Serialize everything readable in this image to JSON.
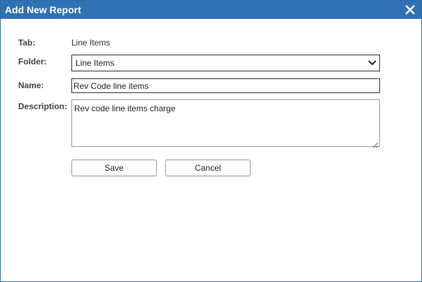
{
  "dialog": {
    "title": "Add New Report",
    "close_icon": "close-icon"
  },
  "form": {
    "tab": {
      "label": "Tab:",
      "value": "Line Items"
    },
    "folder": {
      "label": "Folder:",
      "selected": "Line Items",
      "icon": "chevron-down-icon"
    },
    "name": {
      "label": "Name:",
      "value": "Rev Code line items"
    },
    "description": {
      "label": "Description:",
      "value": "Rev code line items charge"
    }
  },
  "buttons": {
    "save_label": "Save",
    "cancel_label": "Cancel"
  },
  "colors": {
    "titlebar": "#2f72b4",
    "title_text": "#ffffff"
  }
}
